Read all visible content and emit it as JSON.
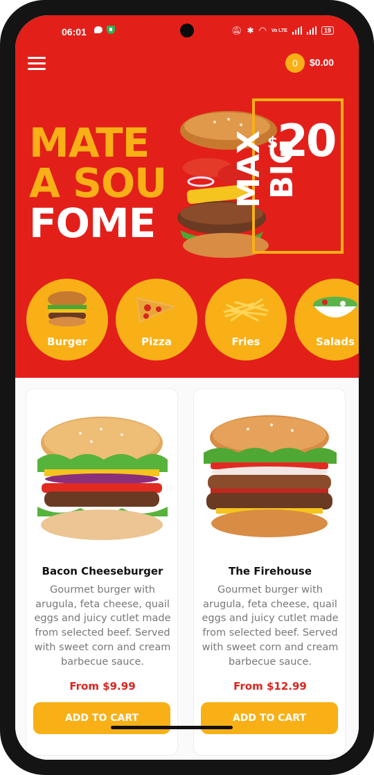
{
  "status_bar": {
    "time": "06:01",
    "battery": "19",
    "network": "Vo LTE"
  },
  "header": {
    "cart_count": "0",
    "cart_total": "$0.00"
  },
  "hero": {
    "lines": [
      "MATE",
      "A SOU",
      "FOME"
    ]
  },
  "promo": {
    "currency": "$",
    "price": "20",
    "product_line1": "BIG",
    "product_line2": "MAX"
  },
  "categories": [
    {
      "label": "Burger",
      "icon": "burger-icon"
    },
    {
      "label": "Pizza",
      "icon": "pizza-slice-icon"
    },
    {
      "label": "Fries",
      "icon": "fries-icon"
    },
    {
      "label": "Salads",
      "icon": "salad-bowl-icon"
    }
  ],
  "products": [
    {
      "title": "Bacon Cheeseburger",
      "description": "Gourmet burger with arugula, feta cheese, quail eggs and juicy cutlet made from selected beef. Served with sweet corn and cream barbecue sauce.",
      "price": "From $9.99",
      "button": "ADD TO CART"
    },
    {
      "title": "The Firehouse",
      "description": "Gourmet burger with arugula, feta cheese, quail eggs and juicy cutlet made from selected beef. Served with sweet corn and cream barbecue sauce.",
      "price": "From $12.99",
      "button": "ADD TO CART"
    }
  ],
  "colors": {
    "brand_red": "#e31f1a",
    "accent_yellow": "#f8b016",
    "price_red": "#d8251d"
  }
}
